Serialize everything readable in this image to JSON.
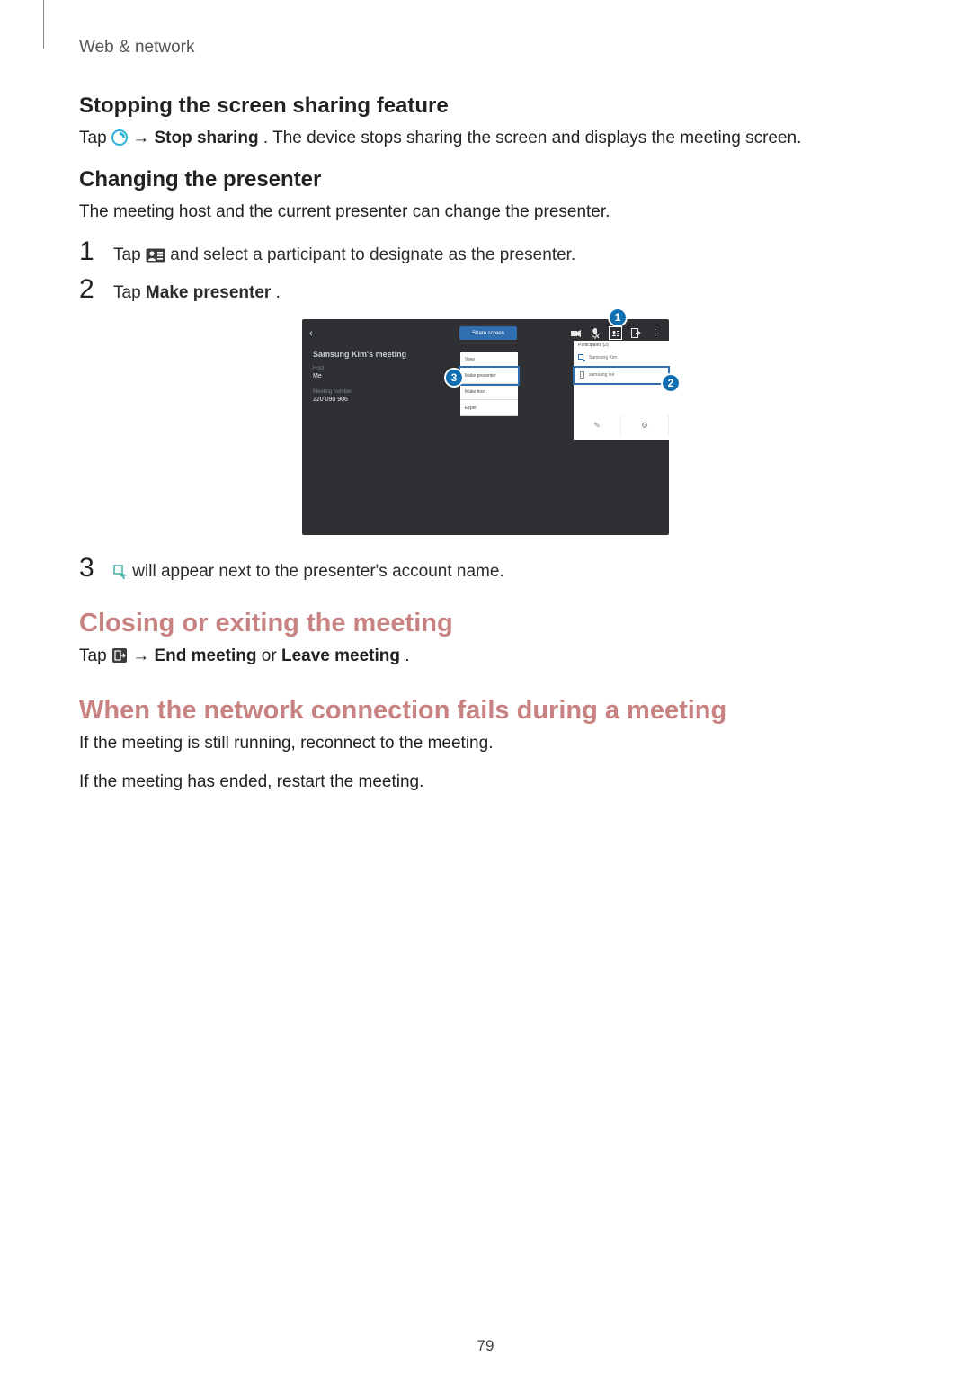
{
  "breadcrumb": "Web & network",
  "page_number": "79",
  "section1": {
    "h": "Stopping the screen sharing feature",
    "para_pre": "Tap ",
    "arrow": " → ",
    "para_bold": "Stop sharing",
    "para_post": ". The device stops sharing the screen and displays the meeting screen."
  },
  "section2": {
    "h": "Changing the presenter",
    "para": "The meeting host and the current presenter can change the presenter.",
    "steps": [
      {
        "n": "1",
        "pre": "Tap ",
        "post": " and select a participant to designate as the presenter."
      },
      {
        "n": "2",
        "pre": "Tap ",
        "bold": "Make presenter",
        "post": "."
      },
      {
        "n": "3",
        "pre": "",
        "post": " will appear next to the presenter's account name."
      }
    ]
  },
  "section3": {
    "h": "Closing or exiting the meeting",
    "para_pre": "Tap ",
    "arrow": " → ",
    "bold1": "End meeting",
    "mid": " or ",
    "bold2": "Leave meeting",
    "post": "."
  },
  "section4": {
    "h": "When the network connection fails during a meeting",
    "p1": "If the meeting is still running, reconnect to the meeting.",
    "p2": "If the meeting has ended, restart the meeting."
  },
  "device": {
    "share_btn": "Share screen",
    "meeting_title": "Samsung Kim's meeting",
    "host_label": "Host",
    "host_value": "Me",
    "num_label": "Meeting number",
    "num_value": "220 090 906",
    "center": [
      "View",
      "Make presenter",
      "Make host",
      "Expel"
    ],
    "participants_hdr": "Participants (2)",
    "p1_name": "Samsung Kim",
    "p2_name": "samsung lee",
    "callouts": {
      "c1": "1",
      "c2": "2",
      "c3": "3"
    }
  }
}
